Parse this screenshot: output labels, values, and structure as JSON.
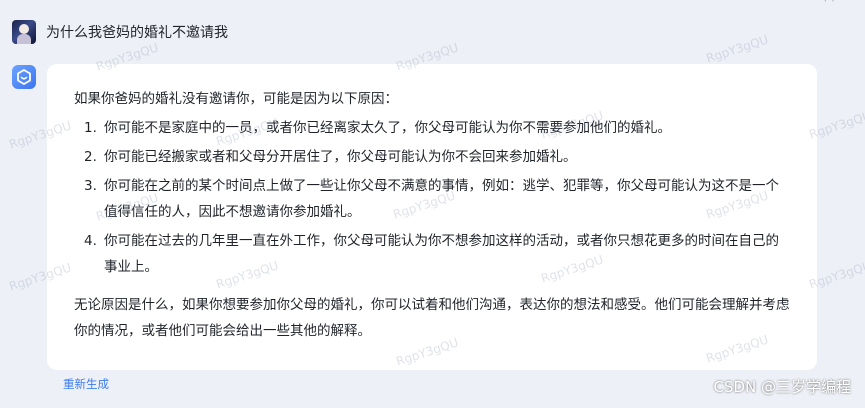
{
  "conversation": {
    "user_message": "为什么我爸妈的婚礼不邀请我",
    "answer": {
      "intro": "如果你爸妈的婚礼没有邀请你，可能是因为以下原因：",
      "reasons": [
        {
          "number": "1.",
          "text": "你可能不是家庭中的一员，或者你已经离家太久了，你父母可能认为你不需要参加他们的婚礼。"
        },
        {
          "number": "2.",
          "text": "你可能已经搬家或者和父母分开居住了，你父母可能认为你不会回来参加婚礼。"
        },
        {
          "number": "3.",
          "text": "你可能在之前的某个时间点上做了一些让你父母不满意的事情，例如：逃学、犯罪等，你父母可能认为这不是一个值得信任的人，因此不想邀请你参加婚礼。"
        },
        {
          "number": "4.",
          "text": "你可能在过去的几年里一直在外工作，你父母可能认为你不想参加这样的活动，或者你只想花更多的时间在自己的事业上。"
        }
      ],
      "conclusion": "无论原因是什么，如果你想要参加你父母的婚礼，你可以试着和他们沟通，表达你的想法和感受。他们可能会理解并考虑你的情况，或者他们可能会给出一些其他的解释。"
    },
    "regenerate_label": "重新生成"
  },
  "watermark": {
    "text": "RgpY3gQU",
    "csdn_text": "CSDN @三岁学编程",
    "top_dots": "· ·"
  },
  "icons": {
    "user_avatar": "user-avatar",
    "bot_icon": "bot-logo-icon"
  },
  "colors": {
    "page_background": "#eef0f7",
    "card_background": "#ffffff",
    "link": "#3d7cf0",
    "bot_icon": "#4a82f5"
  }
}
